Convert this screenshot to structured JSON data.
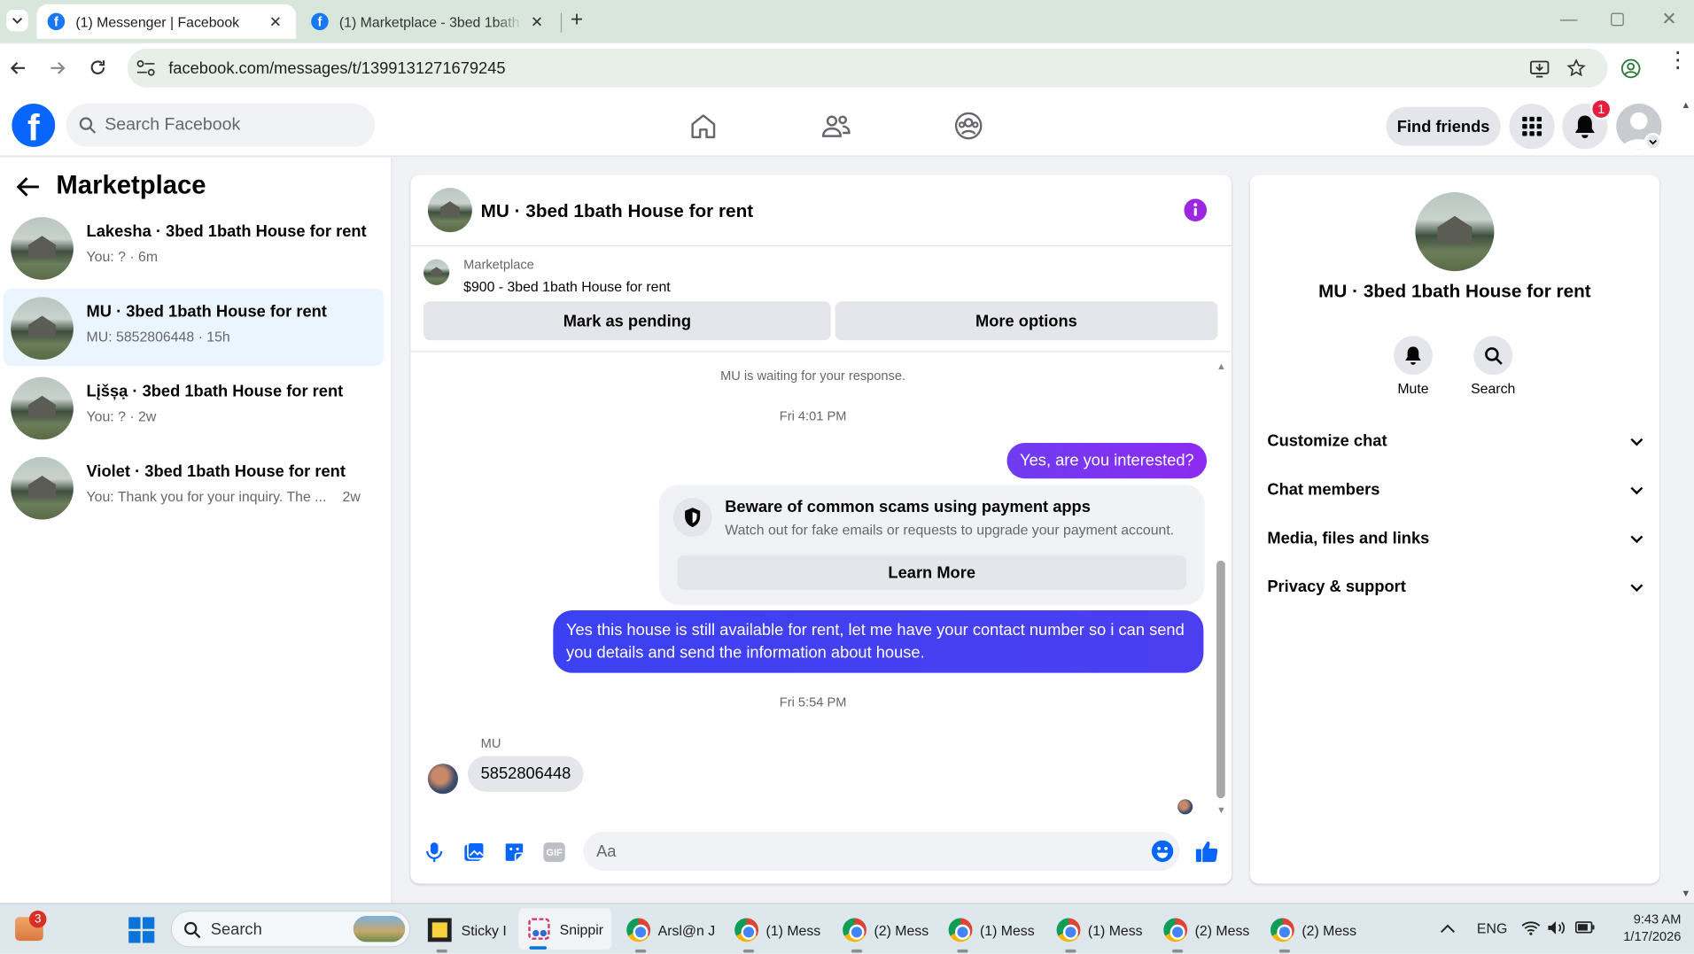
{
  "browser": {
    "tabs": [
      {
        "title": "(1) Messenger | Facebook",
        "active": true
      },
      {
        "title": "(1) Marketplace - 3bed 1bath H",
        "active": false
      }
    ],
    "url": "facebook.com/messages/t/1399131271679245"
  },
  "fb_header": {
    "search_placeholder": "Search Facebook",
    "find_friends": "Find friends",
    "notification_count": "1"
  },
  "left_panel": {
    "title": "Marketplace",
    "conversations": [
      {
        "name": "Lakesha · 3bed 1bath House for rent",
        "preview": "You: ? · 6m",
        "time": ""
      },
      {
        "name": "MU · 3bed 1bath House for rent",
        "preview": "MU: 5852806448 · 15h",
        "time": ""
      },
      {
        "name": "Lįšșạ · 3bed 1bath House for rent",
        "preview": "You: ? · 2w",
        "time": ""
      },
      {
        "name": "Violet · 3bed 1bath House for rent",
        "preview": "You: Thank you for your inquiry. The ...",
        "time": "2w"
      }
    ]
  },
  "chat": {
    "title": "MU · 3bed 1bath House for rent",
    "listing_source": "Marketplace",
    "listing": "$900 - 3bed 1bath House for rent",
    "mark_pending": "Mark as pending",
    "more_options": "More options",
    "waiting_note": "MU is waiting for your response.",
    "time1": "Fri 4:01 PM",
    "msg1": "Yes, are you interested?",
    "scam_title": "Beware of common scams using payment apps",
    "scam_text": "Watch out for fake emails or requests to upgrade your payment account.",
    "learn_more": "Learn More",
    "msg2": "Yes this house is still available for rent, let me have your contact number so i can send you details and send the information about house.",
    "time2": "Fri 5:54 PM",
    "sender": "MU",
    "msg3": "5852806448",
    "composer_placeholder": "Aa"
  },
  "right_panel": {
    "title": "MU · 3bed 1bath House for rent",
    "mute": "Mute",
    "search": "Search",
    "sections": [
      "Customize chat",
      "Chat members",
      "Media, files and links",
      "Privacy & support"
    ]
  },
  "taskbar": {
    "weather_badge": "3",
    "search": "Search",
    "apps": [
      "Sticky I",
      "Snippir",
      "Arsl@n J",
      "(1) Mess",
      "(2) Mess",
      "(1) Mess",
      "(1) Mess",
      "(2) Mess",
      "(2) Mess"
    ],
    "language": "ENG",
    "time": "9:43 AM",
    "date": "1/17/2026"
  }
}
